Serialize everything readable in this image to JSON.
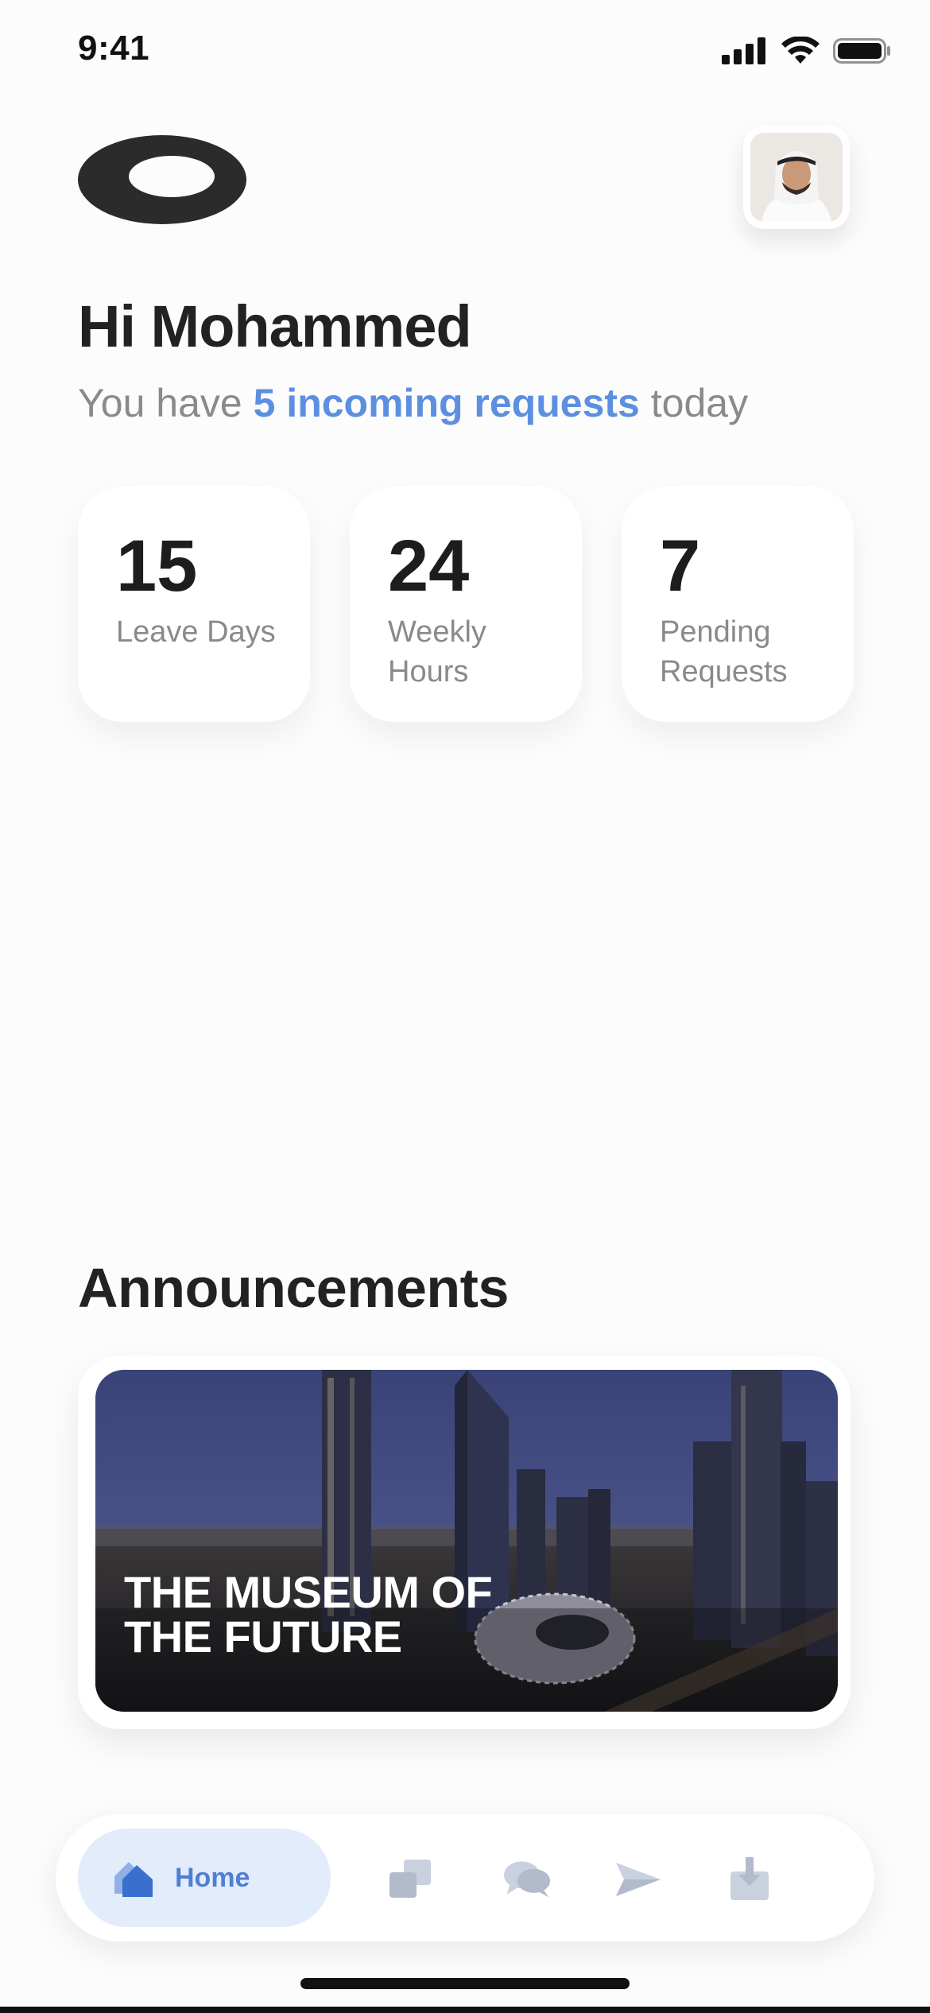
{
  "status_bar": {
    "time": "9:41"
  },
  "header": {
    "logo_icon": "oval-ring-logo",
    "avatar_icon": "user-avatar"
  },
  "greeting": {
    "title": "Hi Mohammed",
    "subtitle_prefix": "You have",
    "subtitle_highlight": "5 incoming requests",
    "subtitle_suffix": "today",
    "highlight_color": "#5c8fe0"
  },
  "stats": [
    {
      "value": "15",
      "label": "Leave Days"
    },
    {
      "value": "24",
      "label": "Weekly Hours"
    },
    {
      "value": "7",
      "label": "Pending Requests"
    }
  ],
  "announcements": {
    "title": "Announcements",
    "cards": [
      {
        "title": "THE MUSEUM OF THE FUTURE",
        "image": "dubai-skyline-night"
      }
    ]
  },
  "tab_bar": {
    "active_color": "#4f7fd4",
    "items": [
      {
        "label": "Home",
        "icon": "home-icon",
        "active": true
      },
      {
        "label": "",
        "icon": "stacked-squares-icon",
        "active": false
      },
      {
        "label": "",
        "icon": "chat-bubbles-icon",
        "active": false
      },
      {
        "label": "",
        "icon": "paper-plane-icon",
        "active": false
      },
      {
        "label": "",
        "icon": "download-tray-icon",
        "active": false
      }
    ]
  }
}
